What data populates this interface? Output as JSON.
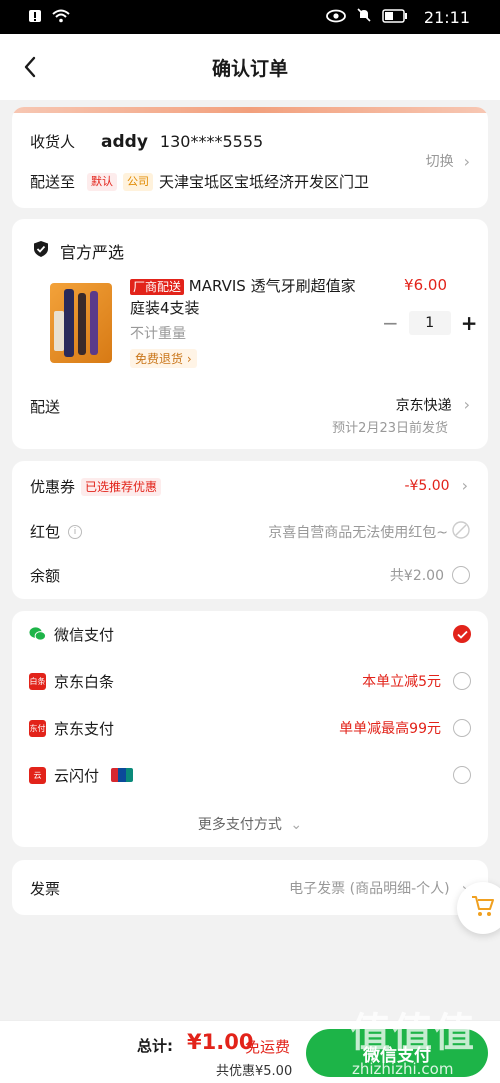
{
  "status_bar": {
    "time": "21:11"
  },
  "nav": {
    "title": "确认订单"
  },
  "address": {
    "receiver_label": "收货人",
    "name": "addy",
    "phone": "130****5555",
    "switch_label": "切换",
    "deliver_to_label": "配送至",
    "tag_default": "默认",
    "tag_company": "公司",
    "address": "天津宝坻区宝坻经济开发区门卫"
  },
  "shop": {
    "name": "官方严选",
    "product": {
      "badge": "厂商配送",
      "title": "MARVIS 透气牙刷超值家庭装4支装",
      "price": "¥6.00",
      "weight": "不计重量",
      "return_tag": "免费退货",
      "quantity": "1"
    },
    "delivery_label": "配送",
    "delivery_method": "京东快递",
    "delivery_eta": "预计2月23日前发货"
  },
  "discounts": {
    "coupon_label": "优惠券",
    "coupon_tag": "已选推荐优惠",
    "coupon_value": "-¥5.00",
    "redpacket_label": "红包",
    "redpacket_value": "京喜自营商品无法使用红包~",
    "balance_label": "余额",
    "balance_value": "共¥2.00"
  },
  "payments": [
    {
      "label": "微信支付",
      "note": "",
      "selected": true
    },
    {
      "label": "京东白条",
      "note": "本单立减5元",
      "selected": false
    },
    {
      "label": "京东支付",
      "note": "单单减最高99元",
      "selected": false
    },
    {
      "label": "云闪付",
      "note": "",
      "selected": false
    }
  ],
  "more_payments": "更多支付方式",
  "invoice": {
    "label": "发票",
    "value": "电子发票 (商品明细-个人)"
  },
  "bottom": {
    "total_label": "总计:",
    "total_value": "¥1.00",
    "free_shipping": "免运费",
    "saved": "共优惠¥5.00",
    "pay_button": "微信支付"
  },
  "watermark": {
    "text": "值值值",
    "url": "zhizhizhi.com"
  },
  "colors": {
    "accent": "#e2231a",
    "wechat_green": "#1db448"
  }
}
